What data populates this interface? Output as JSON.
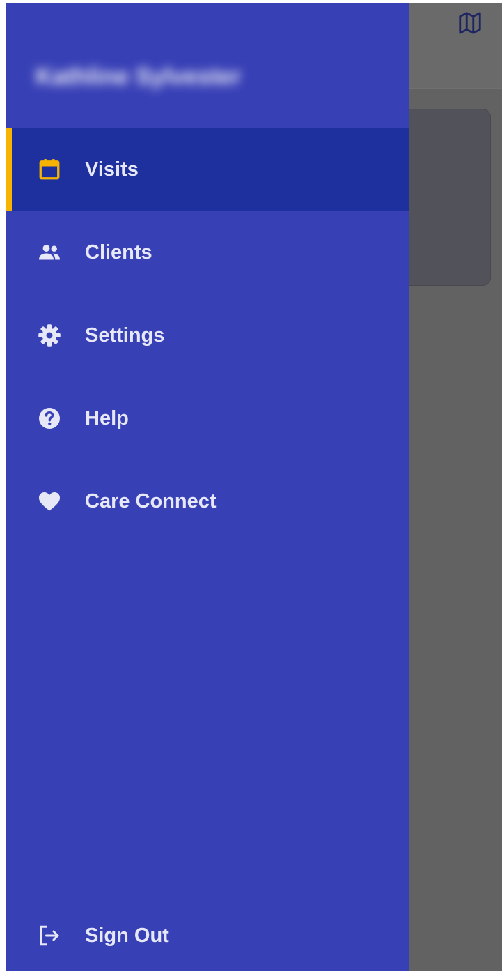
{
  "drawer": {
    "user_name": "Kathline Sylvester",
    "items": [
      {
        "label": "Visits",
        "icon": "calendar-icon",
        "active": true
      },
      {
        "label": "Clients",
        "icon": "people-icon",
        "active": false
      },
      {
        "label": "Settings",
        "icon": "gear-icon",
        "active": false
      },
      {
        "label": "Help",
        "icon": "help-circle-icon",
        "active": false
      },
      {
        "label": "Care Connect",
        "icon": "heart-icon",
        "active": false
      }
    ],
    "sign_out": {
      "label": "Sign Out",
      "icon": "sign-out-icon"
    }
  },
  "background": {
    "header_icon": "map-icon"
  },
  "colors": {
    "drawer": "#3840b6",
    "active_item": "#1e2f9e",
    "accent": "#f6b400",
    "label": "#e7e8f7",
    "overlay": "#626262"
  }
}
